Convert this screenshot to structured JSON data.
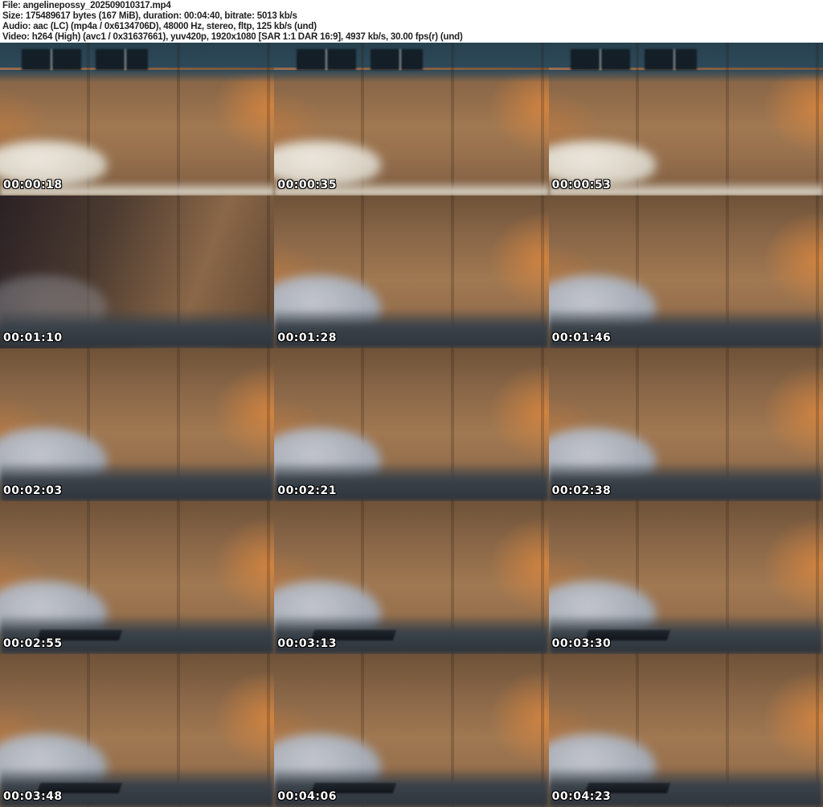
{
  "header": {
    "file_line": "File: angelinepossy_202509010317.mp4",
    "size_line": "Size: 175489617 bytes (167 MiB), duration: 00:04:40, bitrate: 5013 kb/s",
    "audio_line": "Audio: aac (LC) (mp4a / 0x6134706D), 48000 Hz, stereo, fltp, 125 kb/s (und)",
    "video_line": "Video: h264 (High) (avc1 / 0x31637661), yuv420p, 1920x1080 [SAR 1:1 DAR 16:9], 4937 kb/s, 30.00 fps(r) (und)"
  },
  "file": {
    "name": "angelinepossy_202509010317.mp4",
    "size_bytes": "175489617",
    "size_human": "167 MiB",
    "duration": "00:04:40",
    "bitrate": "5013 kb/s",
    "audio_codec": "aac (LC) (mp4a / 0x6134706D)",
    "audio_sample_rate": "48000 Hz",
    "audio_channels": "stereo",
    "audio_format": "fltp",
    "audio_bitrate": "125 kb/s",
    "video_codec": "h264 (High) (avc1 / 0x31637661)",
    "pixel_format": "yuv420p",
    "resolution": "1920x1080",
    "aspect": "[SAR 1:1 DAR 16:9]",
    "video_bitrate": "4937 kb/s",
    "framerate": "30.00 fps(r)"
  },
  "grid": {
    "columns": 3,
    "rows": 5
  },
  "thumbnails": [
    {
      "timestamp": "00:00:18"
    },
    {
      "timestamp": "00:00:35"
    },
    {
      "timestamp": "00:00:53"
    },
    {
      "timestamp": "00:01:10"
    },
    {
      "timestamp": "00:01:28"
    },
    {
      "timestamp": "00:01:46"
    },
    {
      "timestamp": "00:02:03"
    },
    {
      "timestamp": "00:02:21"
    },
    {
      "timestamp": "00:02:38"
    },
    {
      "timestamp": "00:02:55"
    },
    {
      "timestamp": "00:03:13"
    },
    {
      "timestamp": "00:03:30"
    },
    {
      "timestamp": "00:03:48"
    },
    {
      "timestamp": "00:04:06"
    },
    {
      "timestamp": "00:04:23"
    }
  ],
  "palette": {
    "page_background": "#ffffff",
    "header_text": "#1f1f1f",
    "timestamp_text": "#ffffff",
    "timestamp_outline": "#000000",
    "couch_brown": "#9a7250",
    "wall_teal": "#2e4a5a",
    "pillow_gray": "#b4bac4",
    "pillow_white": "#e9e5da",
    "outfit_cream": "#e9dfc6",
    "hair_dark": "#1a1a20",
    "lamp_glow_orange": "#e98b3a",
    "bedding_slate": "#3a424a"
  }
}
